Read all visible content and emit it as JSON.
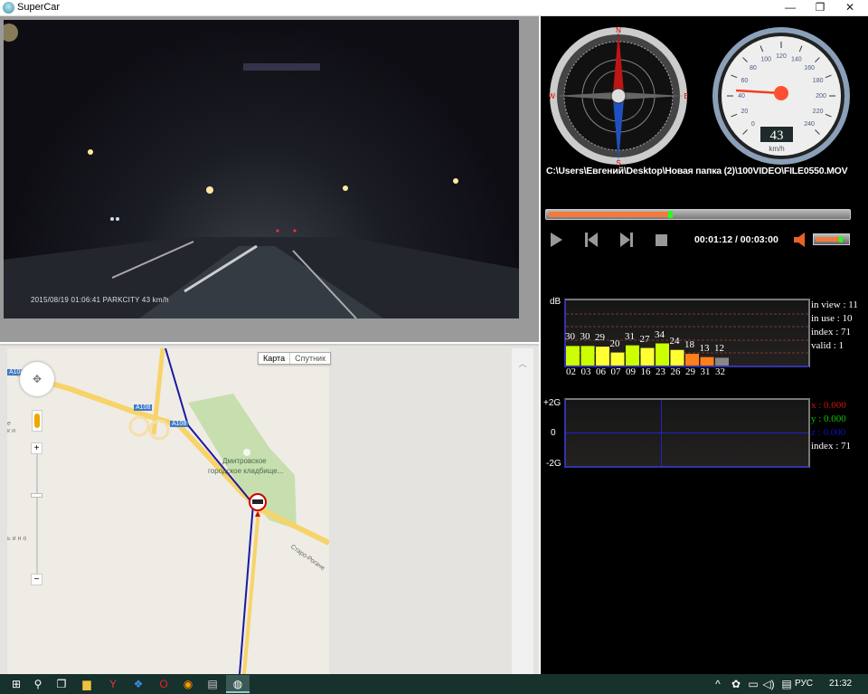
{
  "window": {
    "title": "SuperCar",
    "minimize": "—",
    "maximize": "❐",
    "close": "✕"
  },
  "video": {
    "osd": "2015/08/19 01:06:41  PARKCITY 43 km/h"
  },
  "map": {
    "type_map": "Карта",
    "type_satellite": "Спутник",
    "road_label": "A108",
    "place_name_1": "Дмитровское",
    "place_name_2": "городское кладбище...",
    "street": "Старо-Рогаче",
    "area_1": "е",
    "area_2": "ки",
    "area_3": "ьино",
    "zoom_in": "+",
    "zoom_out": "−"
  },
  "compass": {
    "n": "N",
    "s": "S",
    "e": "E",
    "w": "W"
  },
  "speedometer": {
    "speed": "43",
    "unit": "km/h",
    "speed_value": 43,
    "ticks": [
      "0",
      "20",
      "40",
      "60",
      "80",
      "100",
      "120",
      "140",
      "160",
      "180",
      "200",
      "220",
      "240"
    ]
  },
  "player": {
    "file_path": "C:\\Users\\Евгений\\Desktop\\Новая папка (2)\\100VIDEO\\FILE0550.MOV",
    "time": "00:01:12 / 00:03:00",
    "progress_fraction": 0.4,
    "volume_fraction": 0.85
  },
  "chart_data": [
    {
      "type": "bar",
      "title": "",
      "ylabel": "dB",
      "ylim": [
        0,
        100
      ],
      "categories": [
        "02",
        "03",
        "06",
        "07",
        "09",
        "16",
        "23",
        "26",
        "29",
        "31",
        "32"
      ],
      "values": [
        30,
        30,
        29,
        20,
        31,
        27,
        34,
        24,
        18,
        13,
        12
      ],
      "colors": [
        "#ccff00",
        "#ccff00",
        "#ffff33",
        "#ffff33",
        "#ccff00",
        "#ffff33",
        "#ccff00",
        "#ffff33",
        "#ff7f1a",
        "#ff7f1a",
        "#888888"
      ]
    },
    {
      "type": "line",
      "title": "G-sensor",
      "yticks": [
        "+2G",
        "0",
        "-2G"
      ],
      "ylim": [
        -2,
        2
      ],
      "series": []
    }
  ],
  "gps": {
    "in_view": "in view : 11",
    "in_use": "in use : 10",
    "index": "index : 71",
    "valid": "valid : 1"
  },
  "gsensor": {
    "x": "x : 0.000",
    "y": "y : 0.000",
    "z": "z : 0.000",
    "index": "index : 71",
    "colors": {
      "x": "#d01010",
      "y": "#10c010",
      "z": "#1010c0"
    }
  },
  "taskbar": {
    "lang": "РУС",
    "clock": "21:32"
  }
}
